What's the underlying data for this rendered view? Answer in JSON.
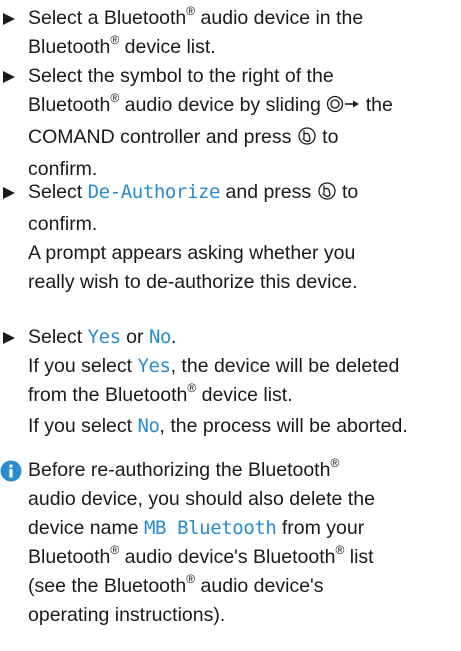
{
  "steps": [
    {
      "lines": [
        [
          "Select a Bluetooth",
          "®",
          " audio device in the"
        ],
        [
          "Bluetooth",
          "®",
          " device list."
        ]
      ]
    },
    {
      "l1": "Select the symbol to the right of the",
      "l2a": "Bluetooth",
      "l2reg": "®",
      "l2b": " audio device by sliding ",
      "l2c": " the",
      "l3a": "COMAND controller and press ",
      "l3b": " to",
      "l4": "confirm."
    },
    {
      "l1a": "Select ",
      "l1sw": "De-Authorize",
      "l1b": " and press ",
      "l1c": " to",
      "l2": "confirm.",
      "l3": "A prompt appears asking whether you",
      "l4": "really wish to de-authorize this device."
    },
    {
      "l1a": "Select ",
      "yes": "Yes",
      "l1b": " or ",
      "no": "No",
      "l1c": ".",
      "l2a": "If you select ",
      "l2b": ", the device will be deleted",
      "l3a": "from the Bluetooth",
      "l3reg": "®",
      "l3b": " device list.",
      "l4a": "If you select ",
      "l4b": ", the process will be aborted."
    }
  ],
  "note": {
    "l1a": "Before re-authorizing the Bluetooth",
    "l1reg": "®",
    "l2": "audio device, you should also delete the",
    "l3a": "device name ",
    "l3sw": "MB Bluetooth",
    "l3b": " from your",
    "l4a": "Bluetooth",
    "l4reg": "®",
    "l4b": " audio device's Bluetooth",
    "l4reg2": "®",
    "l4c": " list",
    "l5a": "(see the Bluetooth",
    "l5reg": "®",
    "l5b": " audio device's",
    "l6": "operating instructions)."
  },
  "icons": {
    "bullet": "triangle-bullet-icon",
    "slide_right": "controller-slide-right-icon",
    "press": "controller-press-icon",
    "info": "info-icon"
  },
  "colors": {
    "text": "#1a1a1a",
    "software_label": "#2a8ccc",
    "info_icon": "#2a8ccc"
  }
}
